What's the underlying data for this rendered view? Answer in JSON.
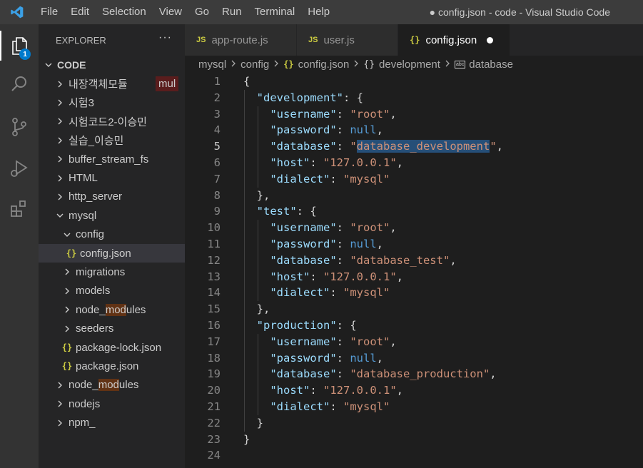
{
  "titlebar": {
    "menu": [
      "File",
      "Edit",
      "Selection",
      "View",
      "Go",
      "Run",
      "Terminal",
      "Help"
    ],
    "window_title": "● config.json - code - Visual Studio Code"
  },
  "activity": {
    "explorer_badge": "1"
  },
  "sidebar": {
    "header": "EXPLORER",
    "more": "···",
    "root": "CODE",
    "mul_badge": "mul",
    "items": [
      {
        "label": "내장객체모듈",
        "type": "folder",
        "depth": 0,
        "open": false
      },
      {
        "label": "시험3",
        "type": "folder",
        "depth": 0,
        "open": false
      },
      {
        "label": "시험코드2-이승민",
        "type": "folder",
        "depth": 0,
        "open": false
      },
      {
        "label": "실습_이승민",
        "type": "folder",
        "depth": 0,
        "open": false
      },
      {
        "label": "buffer_stream_fs",
        "type": "folder",
        "depth": 0,
        "open": false
      },
      {
        "label": "HTML",
        "type": "folder",
        "depth": 0,
        "open": false
      },
      {
        "label": "http_server",
        "type": "folder",
        "depth": 0,
        "open": false
      },
      {
        "label": "mysql",
        "type": "folder",
        "depth": 0,
        "open": true
      },
      {
        "label": "config",
        "type": "folder",
        "depth": 1,
        "open": true
      },
      {
        "label": "config.json",
        "type": "json",
        "depth": 2,
        "selected": true
      },
      {
        "label": "migrations",
        "type": "folder",
        "depth": 1,
        "open": false
      },
      {
        "label": "models",
        "type": "folder",
        "depth": 1,
        "open": false
      },
      {
        "label": "node_modules",
        "type": "folder",
        "depth": 1,
        "open": false
      },
      {
        "label": "seeders",
        "type": "folder",
        "depth": 1,
        "open": false
      },
      {
        "label": "package-lock.json",
        "type": "json",
        "depth": 1
      },
      {
        "label": "package.json",
        "type": "json",
        "depth": 1
      },
      {
        "label": "node_modules",
        "type": "folder",
        "depth": 0,
        "open": false
      },
      {
        "label": "nodejs",
        "type": "folder",
        "depth": 0,
        "open": false
      },
      {
        "label": "npm_",
        "type": "folder",
        "depth": 0,
        "open": false
      }
    ]
  },
  "tabs": [
    {
      "icon": "JS",
      "label": "app-route.js",
      "active": false
    },
    {
      "icon": "JS",
      "label": "user.js",
      "active": false
    },
    {
      "icon": "{}",
      "label": "config.json",
      "active": true,
      "dirty": true
    }
  ],
  "breadcrumb": [
    "mysql",
    "config",
    "config.json",
    "development",
    "database"
  ],
  "editor": {
    "current_line": 5,
    "lines": [
      {
        "n": "1",
        "tokens": [
          [
            "p",
            "{"
          ]
        ]
      },
      {
        "n": "2",
        "tokens": [
          [
            "p",
            "  "
          ],
          [
            "k",
            "\"development\""
          ],
          [
            "p",
            ": {"
          ]
        ]
      },
      {
        "n": "3",
        "tokens": [
          [
            "p",
            "    "
          ],
          [
            "k",
            "\"username\""
          ],
          [
            "p",
            ": "
          ],
          [
            "s",
            "\"root\""
          ],
          [
            "p",
            ","
          ]
        ]
      },
      {
        "n": "4",
        "tokens": [
          [
            "p",
            "    "
          ],
          [
            "k",
            "\"password\""
          ],
          [
            "p",
            ": "
          ],
          [
            "n",
            "null"
          ],
          [
            "p",
            ","
          ]
        ]
      },
      {
        "n": "5",
        "tokens": [
          [
            "p",
            "    "
          ],
          [
            "k",
            "\"database\""
          ],
          [
            "p",
            ": "
          ],
          [
            "s",
            "\""
          ],
          [
            "s sel",
            "database_development"
          ],
          [
            "s",
            "\""
          ],
          [
            "p",
            ","
          ]
        ]
      },
      {
        "n": "6",
        "tokens": [
          [
            "p",
            "    "
          ],
          [
            "k",
            "\"host\""
          ],
          [
            "p",
            ": "
          ],
          [
            "s",
            "\"127.0.0.1\""
          ],
          [
            "p",
            ","
          ]
        ]
      },
      {
        "n": "7",
        "tokens": [
          [
            "p",
            "    "
          ],
          [
            "k",
            "\"dialect\""
          ],
          [
            "p",
            ": "
          ],
          [
            "s",
            "\"mysql\""
          ]
        ]
      },
      {
        "n": "8",
        "tokens": [
          [
            "p",
            "  },"
          ]
        ]
      },
      {
        "n": "9",
        "tokens": [
          [
            "p",
            "  "
          ],
          [
            "k",
            "\"test\""
          ],
          [
            "p",
            ": {"
          ]
        ]
      },
      {
        "n": "10",
        "tokens": [
          [
            "p",
            "    "
          ],
          [
            "k",
            "\"username\""
          ],
          [
            "p",
            ": "
          ],
          [
            "s",
            "\"root\""
          ],
          [
            "p",
            ","
          ]
        ]
      },
      {
        "n": "11",
        "tokens": [
          [
            "p",
            "    "
          ],
          [
            "k",
            "\"password\""
          ],
          [
            "p",
            ": "
          ],
          [
            "n",
            "null"
          ],
          [
            "p",
            ","
          ]
        ]
      },
      {
        "n": "12",
        "tokens": [
          [
            "p",
            "    "
          ],
          [
            "k",
            "\"database\""
          ],
          [
            "p",
            ": "
          ],
          [
            "s",
            "\"database_test\""
          ],
          [
            "p",
            ","
          ]
        ]
      },
      {
        "n": "13",
        "tokens": [
          [
            "p",
            "    "
          ],
          [
            "k",
            "\"host\""
          ],
          [
            "p",
            ": "
          ],
          [
            "s",
            "\"127.0.0.1\""
          ],
          [
            "p",
            ","
          ]
        ]
      },
      {
        "n": "14",
        "tokens": [
          [
            "p",
            "    "
          ],
          [
            "k",
            "\"dialect\""
          ],
          [
            "p",
            ": "
          ],
          [
            "s",
            "\"mysql\""
          ]
        ]
      },
      {
        "n": "15",
        "tokens": [
          [
            "p",
            "  },"
          ]
        ]
      },
      {
        "n": "16",
        "tokens": [
          [
            "p",
            "  "
          ],
          [
            "k",
            "\"production\""
          ],
          [
            "p",
            ": {"
          ]
        ]
      },
      {
        "n": "17",
        "tokens": [
          [
            "p",
            "    "
          ],
          [
            "k",
            "\"username\""
          ],
          [
            "p",
            ": "
          ],
          [
            "s",
            "\"root\""
          ],
          [
            "p",
            ","
          ]
        ]
      },
      {
        "n": "18",
        "tokens": [
          [
            "p",
            "    "
          ],
          [
            "k",
            "\"password\""
          ],
          [
            "p",
            ": "
          ],
          [
            "n",
            "null"
          ],
          [
            "p",
            ","
          ]
        ]
      },
      {
        "n": "19",
        "tokens": [
          [
            "p",
            "    "
          ],
          [
            "k",
            "\"database\""
          ],
          [
            "p",
            ": "
          ],
          [
            "s",
            "\"database_production\""
          ],
          [
            "p",
            ","
          ]
        ]
      },
      {
        "n": "20",
        "tokens": [
          [
            "p",
            "    "
          ],
          [
            "k",
            "\"host\""
          ],
          [
            "p",
            ": "
          ],
          [
            "s",
            "\"127.0.0.1\""
          ],
          [
            "p",
            ","
          ]
        ]
      },
      {
        "n": "21",
        "tokens": [
          [
            "p",
            "    "
          ],
          [
            "k",
            "\"dialect\""
          ],
          [
            "p",
            ": "
          ],
          [
            "s",
            "\"mysql\""
          ]
        ]
      },
      {
        "n": "22",
        "tokens": [
          [
            "p",
            "  }"
          ]
        ]
      },
      {
        "n": "23",
        "tokens": [
          [
            "p",
            "}"
          ]
        ]
      },
      {
        "n": "24",
        "tokens": []
      }
    ]
  },
  "colors": {
    "accent": "#007acc",
    "json_icon": "#cbcb41",
    "key": "#9cdcfe",
    "string": "#ce9178",
    "null": "#569cd6",
    "selection": "#264f78"
  }
}
